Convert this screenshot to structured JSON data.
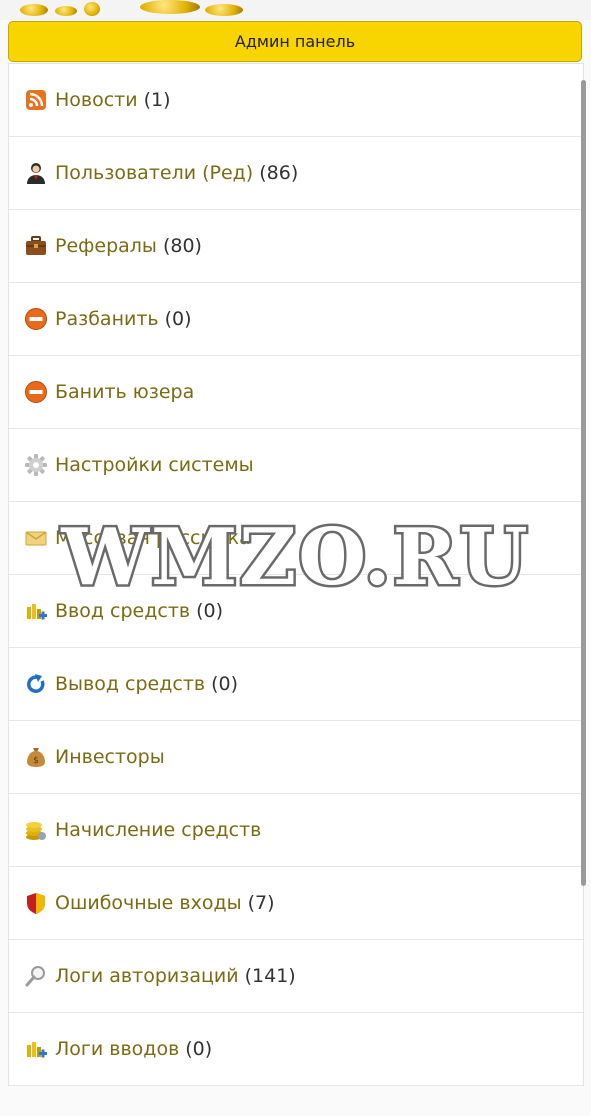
{
  "header": {
    "title": "Админ панель"
  },
  "menu": [
    {
      "label": "Новости",
      "count": "(1)",
      "icon": "rss-icon"
    },
    {
      "label": "Пользователи (Ред)",
      "count": "(86)",
      "icon": "user-icon"
    },
    {
      "label": "Рефералы",
      "count": "(80)",
      "icon": "briefcase-icon"
    },
    {
      "label": "Разбанить",
      "count": "(0)",
      "icon": "unban-icon"
    },
    {
      "label": "Банить юзера",
      "count": "",
      "icon": "ban-icon"
    },
    {
      "label": "Настройки системы",
      "count": "",
      "icon": "gear-icon"
    },
    {
      "label": "Массовая рассылка",
      "count": "",
      "icon": "envelope-icon"
    },
    {
      "label": "Ввод средств",
      "count": "(0)",
      "icon": "deposit-icon"
    },
    {
      "label": "Вывод средств",
      "count": "(0)",
      "icon": "refresh-icon"
    },
    {
      "label": "Инвесторы",
      "count": "",
      "icon": "money-bag-icon"
    },
    {
      "label": "Начисление средств",
      "count": "",
      "icon": "coins-icon"
    },
    {
      "label": "Ошибочные входы",
      "count": "(7)",
      "icon": "shield-icon"
    },
    {
      "label": "Логи авторизаций",
      "count": "(141)",
      "icon": "magnifier-icon"
    },
    {
      "label": "Логи вводов",
      "count": "(0)",
      "icon": "deposit-icon"
    }
  ],
  "watermark": "WMZO.RU"
}
